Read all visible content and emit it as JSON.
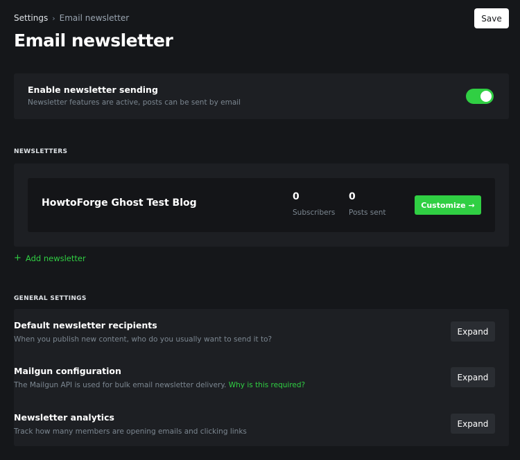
{
  "breadcrumb": {
    "root": "Settings",
    "separator": "›",
    "current": "Email newsletter"
  },
  "header": {
    "title": "Email newsletter",
    "save_label": "Save"
  },
  "enable": {
    "title": "Enable newsletter sending",
    "description": "Newsletter features are active, posts can be sent by email",
    "enabled": true
  },
  "newsletters": {
    "section_label": "NEWSLETTERS",
    "items": [
      {
        "name": "HowtoForge Ghost Test Blog",
        "subscribers_value": "0",
        "subscribers_label": "Subscribers",
        "posts_value": "0",
        "posts_label": "Posts sent",
        "customize_label": "Customize →"
      }
    ],
    "add_label": "Add newsletter",
    "add_icon": "+"
  },
  "general": {
    "section_label": "GENERAL SETTINGS",
    "rows": [
      {
        "title": "Default newsletter recipients",
        "description": "When you publish new content, who do you usually want to send it to?",
        "button": "Expand"
      },
      {
        "title": "Mailgun configuration",
        "description": "The Mailgun API is used for bulk email newsletter delivery.",
        "link": "Why is this required?",
        "button": "Expand"
      },
      {
        "title": "Newsletter analytics",
        "description": "Track how many members are opening emails and clicking links",
        "button": "Expand"
      }
    ]
  },
  "colors": {
    "accent": "#30cf43",
    "background": "#15171a",
    "panel": "#1d1f23"
  }
}
